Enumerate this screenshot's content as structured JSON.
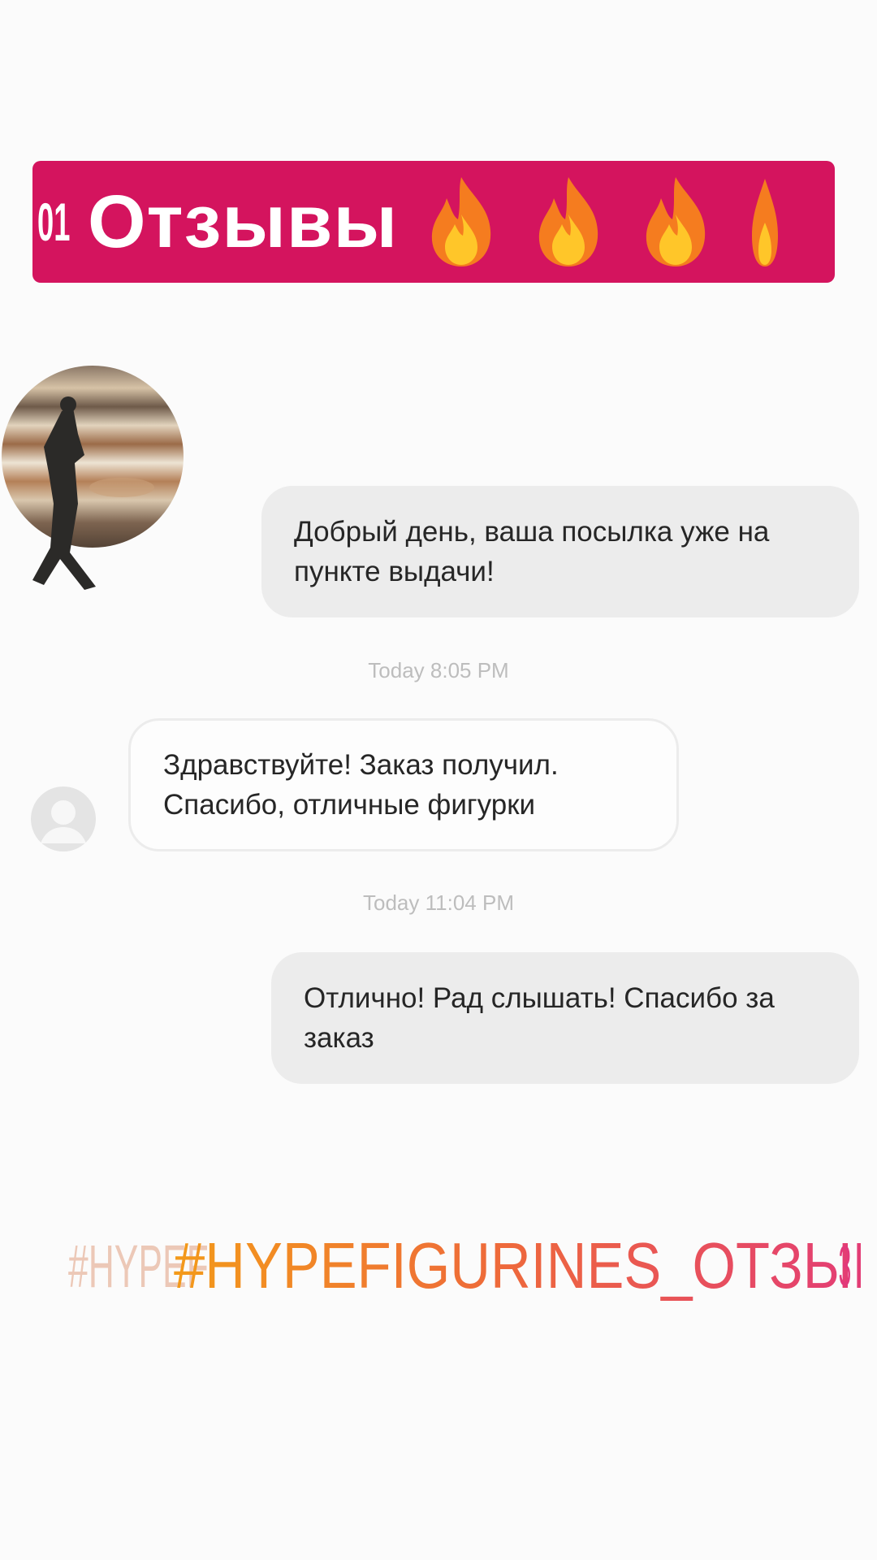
{
  "banner": {
    "prefix": "01",
    "title": "Отзывы",
    "icons": [
      "fire-icon",
      "fire-icon",
      "fire-icon",
      "fire-icon-partial"
    ],
    "background": "#d4145e"
  },
  "messages": [
    {
      "direction": "outgoing",
      "text": "Добрый день, ваша посылка уже на пункте выдачи!"
    },
    {
      "direction": "incoming",
      "text": "Здравствуйте! Заказ получил. Спасибо, отличные фигурки"
    },
    {
      "direction": "outgoing",
      "text": "Отлично! Рад слышать! Спасибо за заказ"
    }
  ],
  "timestamps": [
    "Today 8:05 PM",
    "Today 11:04 PM"
  ],
  "hashtags": {
    "faded": "#HYPEF",
    "main": "#HYPEFIGURINES_ОТЗЫВ",
    "tail": "3"
  }
}
